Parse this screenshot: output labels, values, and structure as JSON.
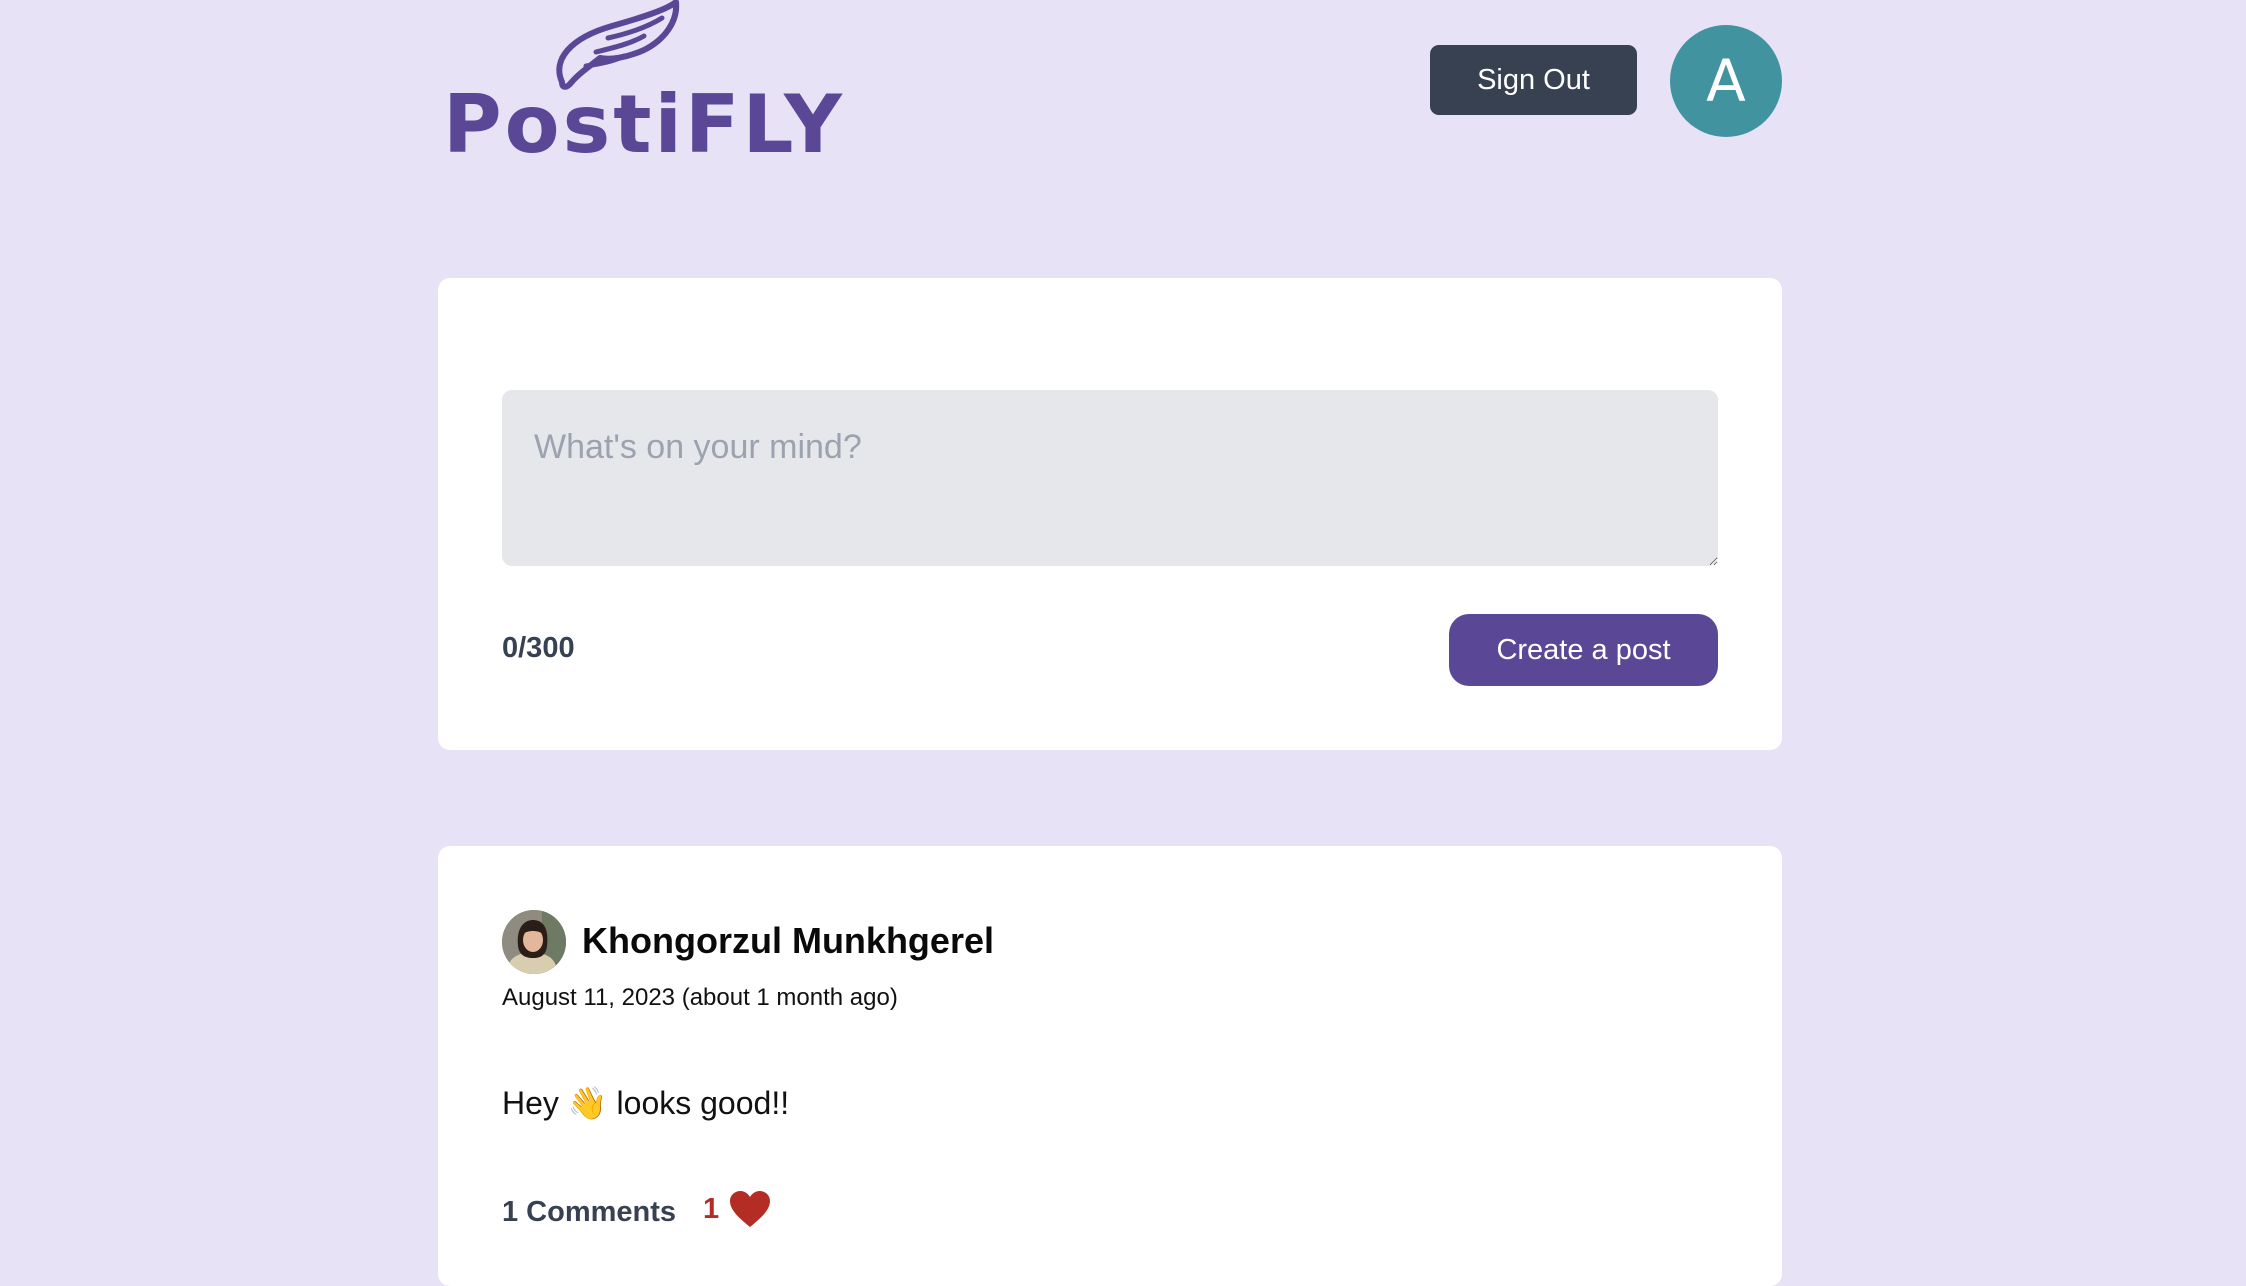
{
  "header": {
    "logo_text": "PostiFLY",
    "sign_out_label": "Sign Out",
    "avatar_initial": "A",
    "avatar_color": "#41939f",
    "brand_color": "#5a4896"
  },
  "composer": {
    "placeholder": "What's on your mind?",
    "char_count": "0/300",
    "submit_label": "Create a post"
  },
  "posts": [
    {
      "author": "Khongorzul Munkhgerel",
      "date": "August 11, 2023 (about 1 month ago)",
      "body": "Hey 👋 looks good!!",
      "comments_label": "1 Comments",
      "likes": "1",
      "like_icon": "heart-icon",
      "like_color": "#b32d25"
    }
  ]
}
